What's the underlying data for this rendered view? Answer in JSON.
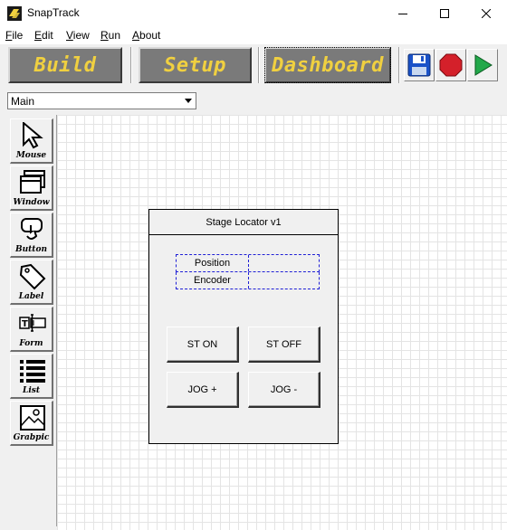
{
  "window": {
    "title": "SnapTrack"
  },
  "menu": [
    "File",
    "Edit",
    "View",
    "Run",
    "About"
  ],
  "toolbar": {
    "modes": [
      "Build",
      "Setup",
      "Dashboard"
    ],
    "active_mode": "Dashboard",
    "actions": [
      {
        "icon": "save-icon",
        "color": "#1a52c8"
      },
      {
        "icon": "stop-icon",
        "color": "#d4202a"
      },
      {
        "icon": "play-icon",
        "color": "#22a84a"
      }
    ],
    "mode_text_color": "#f0d040"
  },
  "combo": {
    "value": "Main"
  },
  "palette": [
    "Mouse",
    "Window",
    "Button",
    "Label",
    "Form",
    "List",
    "Grabpic"
  ],
  "design": {
    "title": "Stage Locator v1",
    "fields": [
      {
        "label": "Position",
        "value": ""
      },
      {
        "label": "Encoder",
        "value": ""
      }
    ],
    "buttons": [
      "ST ON",
      "ST OFF",
      "JOG +",
      "JOG -"
    ],
    "field_border_color": "#1f1fd6"
  }
}
